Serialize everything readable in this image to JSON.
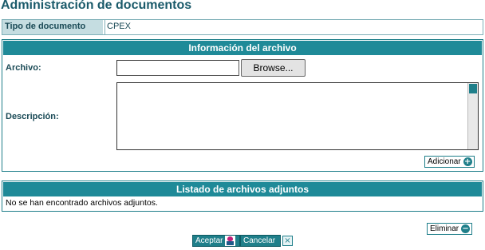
{
  "page": {
    "title": "Administración de documentos"
  },
  "document_type": {
    "label": "Tipo de documento",
    "value": "CPEX"
  },
  "file_info": {
    "header": "Información del archivo",
    "file_label": "Archivo:",
    "file_value": "",
    "browse_label": "Browse...",
    "description_label": "Descripción:",
    "description_value": "",
    "add_label": "Adicionar",
    "add_icon": "plus-circle-icon"
  },
  "attachments": {
    "header": "Listado de archivos adjuntos",
    "empty_message": "No se han encontrado archivos adjuntos.",
    "delete_label": "Eliminar",
    "delete_icon": "minus-circle-icon"
  },
  "actions": {
    "accept_label": "Aceptar",
    "accept_icon": "user-icon",
    "cancel_label": "Cancelar",
    "cancel_icon": "close-box-icon"
  },
  "colors": {
    "accent": "#1f8a98",
    "label_bg": "#c5dde1",
    "title": "#1a5a6a"
  }
}
